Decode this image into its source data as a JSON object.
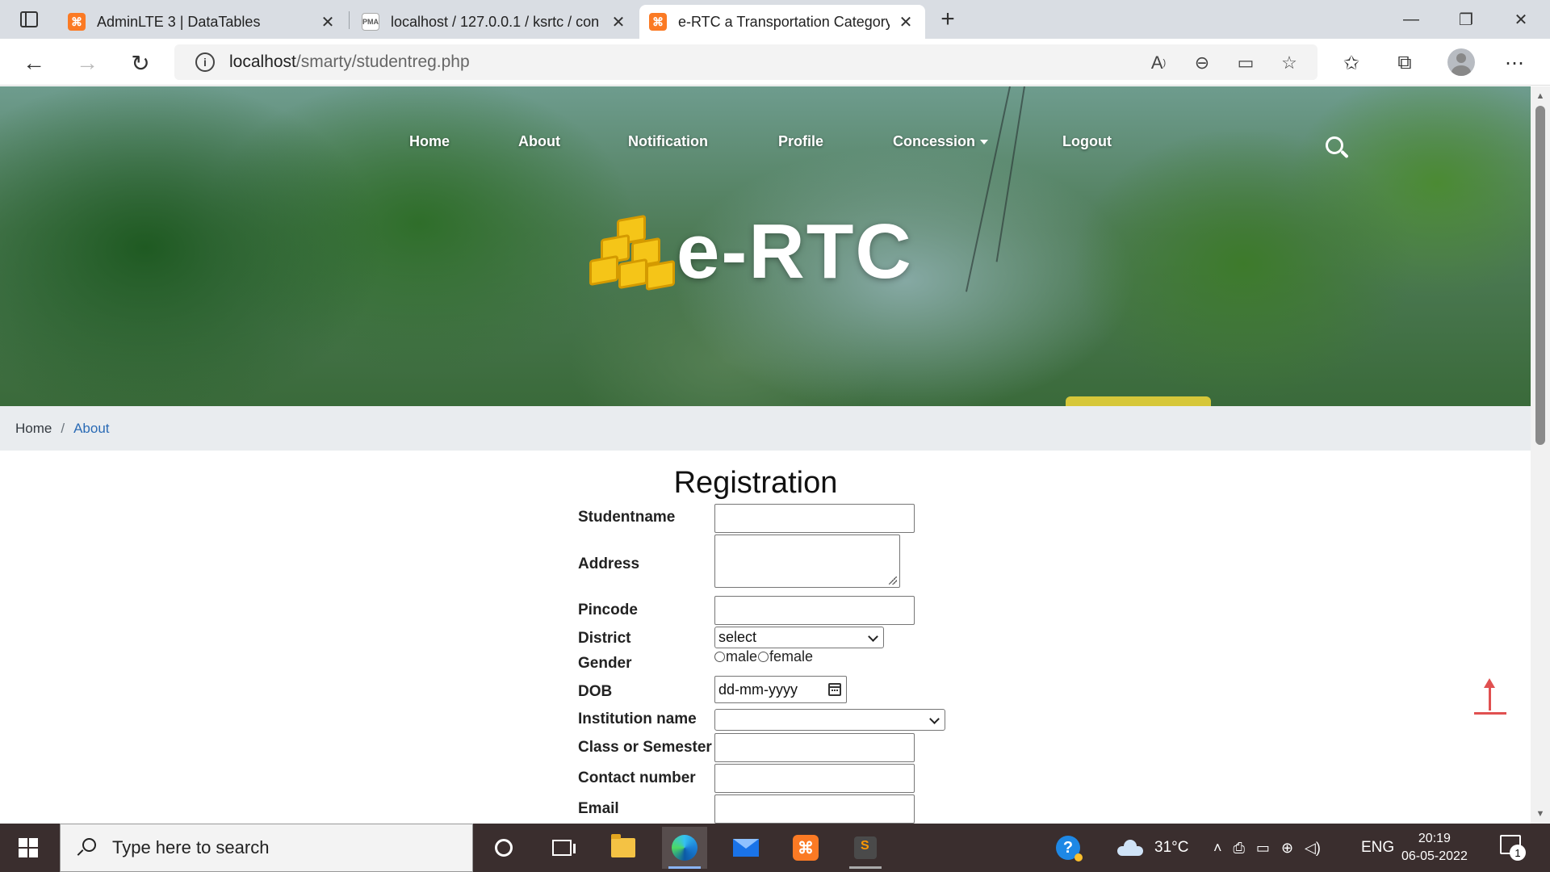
{
  "browser": {
    "tabs": [
      {
        "title": "AdminLTE 3 | DataTables",
        "favicon": "xampp-icon",
        "active": false
      },
      {
        "title": "localhost / 127.0.0.1 / ksrtc / con",
        "favicon": "phpmyadmin-icon",
        "active": false
      },
      {
        "title": "e-RTC a Transportation Category",
        "favicon": "xampp-icon",
        "active": true
      }
    ],
    "url_host": "localhost",
    "url_path": "/smarty/studentreg.php",
    "new_tab": "+",
    "close_glyph": "✕"
  },
  "site": {
    "nav": [
      {
        "label": "Home"
      },
      {
        "label": "About"
      },
      {
        "label": "Notification"
      },
      {
        "label": "Profile"
      },
      {
        "label": "Concession"
      },
      {
        "label": "Logout"
      }
    ],
    "brand": "e-RTC",
    "brand_color": "#f5c518"
  },
  "breadcrumb": {
    "home": "Home",
    "separator": "/",
    "current": "About"
  },
  "form": {
    "title": "Registration",
    "labels": {
      "studentname": "Studentname",
      "address": "Address",
      "pincode": "Pincode",
      "district": "District",
      "gender": "Gender",
      "dob": "DOB",
      "institution": "Institution name",
      "class": "Class or Semester",
      "contact": "Contact number",
      "email": "Email"
    },
    "district_selected": "select",
    "gender_options": [
      "male",
      "female"
    ],
    "dob_placeholder": "dd-mm-yyyy",
    "institution_selected": ""
  },
  "taskbar": {
    "search_placeholder": "Type here to search",
    "weather": "31°C",
    "language": "ENG",
    "time": "20:19",
    "date": "06-05-2022",
    "notification_count": "1"
  }
}
